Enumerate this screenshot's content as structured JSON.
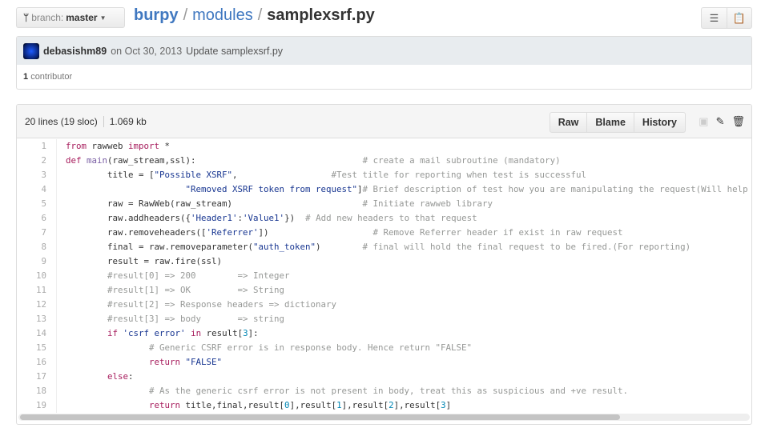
{
  "branch": {
    "prefix": "branch:",
    "name": "master"
  },
  "breadcrumb": {
    "repo": "burpy",
    "folder": "modules",
    "file": "samplexsrf.py",
    "sep": "/"
  },
  "commit": {
    "author": "debasishm89",
    "date": "on Oct 30, 2013",
    "message": "Update samplexsrf.py",
    "contributors_count": "1",
    "contributors_label": "contributor"
  },
  "file": {
    "lines": "20 lines (19 sloc)",
    "size": "1.069 kb",
    "buttons": [
      "Raw",
      "Blame",
      "History"
    ]
  },
  "scroll_fraction": 0.82,
  "code": [
    [
      [
        "k",
        "from"
      ],
      [
        "t",
        " rawweb "
      ],
      [
        "k",
        "import"
      ],
      [
        "t",
        " *"
      ]
    ],
    [
      [
        "k",
        "def"
      ],
      [
        "t",
        " "
      ],
      [
        "f",
        "main"
      ],
      [
        "t",
        "(raw_stream,ssl):                                "
      ],
      [
        "c",
        "# create a mail subroutine (mandatory)"
      ]
    ],
    [
      [
        "t",
        "        title = ["
      ],
      [
        "s",
        "\"Possible XSRF\""
      ],
      [
        "t",
        ",                  "
      ],
      [
        "c",
        "#Test title for reporting when test is successful"
      ]
    ],
    [
      [
        "t",
        "                       "
      ],
      [
        "s",
        "\"Removed XSRF token from request\""
      ],
      [
        "t",
        "]"
      ],
      [
        "c",
        "# Brief description of test how you are manipulating the request(Will help"
      ]
    ],
    [
      [
        "t",
        "        raw = RawWeb(raw_stream)                         "
      ],
      [
        "c",
        "# Initiate rawweb library"
      ]
    ],
    [
      [
        "t",
        "        raw.addheaders({"
      ],
      [
        "s",
        "'Header1'"
      ],
      [
        "t",
        ":"
      ],
      [
        "s",
        "'Value1'"
      ],
      [
        "t",
        "})  "
      ],
      [
        "c",
        "# Add new headers to that request"
      ]
    ],
    [
      [
        "t",
        "        raw.removeheaders(["
      ],
      [
        "s",
        "'Referrer'"
      ],
      [
        "t",
        "])                    "
      ],
      [
        "c",
        "# Remove Referrer header if exist in raw request"
      ]
    ],
    [
      [
        "t",
        "        final = raw.removeparameter("
      ],
      [
        "s",
        "\"auth_token\""
      ],
      [
        "t",
        ")        "
      ],
      [
        "c",
        "# final will hold the final request to be fired.(For reporting)"
      ]
    ],
    [
      [
        "t",
        "        result = raw.fire(ssl)"
      ]
    ],
    [
      [
        "c",
        "        #result[0] => 200        => Integer"
      ]
    ],
    [
      [
        "c",
        "        #result[1] => OK         => String"
      ]
    ],
    [
      [
        "c",
        "        #result[2] => Response headers => dictionary"
      ]
    ],
    [
      [
        "c",
        "        #result[3] => body       => string"
      ]
    ],
    [
      [
        "t",
        "        "
      ],
      [
        "k",
        "if"
      ],
      [
        "t",
        " "
      ],
      [
        "s",
        "'csrf error'"
      ],
      [
        "t",
        " "
      ],
      [
        "k",
        "in"
      ],
      [
        "t",
        " result["
      ],
      [
        "n",
        "3"
      ],
      [
        "t",
        "]:"
      ]
    ],
    [
      [
        "c",
        "                # Generic CSRF error is in response body. Hence return \"FALSE\""
      ]
    ],
    [
      [
        "t",
        "                "
      ],
      [
        "k",
        "return"
      ],
      [
        "t",
        " "
      ],
      [
        "s",
        "\"FALSE\""
      ]
    ],
    [
      [
        "t",
        "        "
      ],
      [
        "k",
        "else"
      ],
      [
        "t",
        ":"
      ]
    ],
    [
      [
        "c",
        "                # As the generic csrf error is not present in body, treat this as suspicious and +ve result."
      ]
    ],
    [
      [
        "t",
        "                "
      ],
      [
        "k",
        "return"
      ],
      [
        "t",
        " title,final,result["
      ],
      [
        "n",
        "0"
      ],
      [
        "t",
        "],result["
      ],
      [
        "n",
        "1"
      ],
      [
        "t",
        "],result["
      ],
      [
        "n",
        "2"
      ],
      [
        "t",
        "],result["
      ],
      [
        "n",
        "3"
      ],
      [
        "t",
        "]"
      ]
    ]
  ]
}
